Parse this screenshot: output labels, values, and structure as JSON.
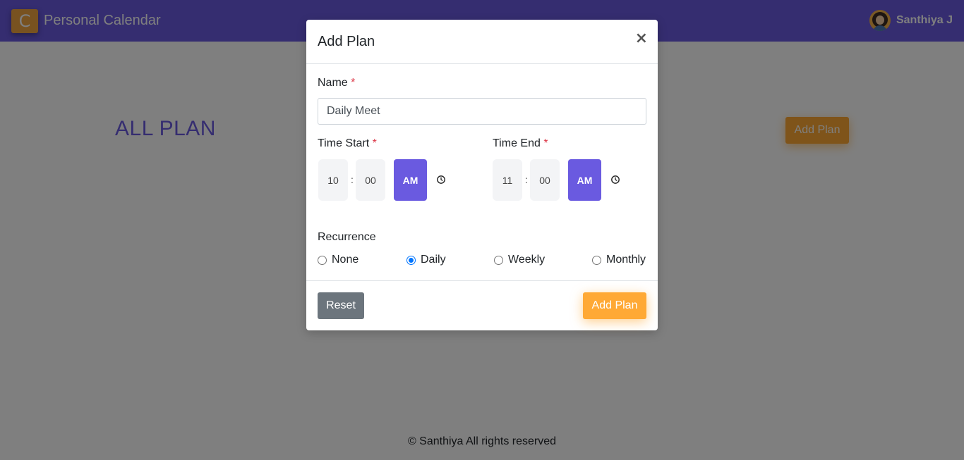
{
  "app": {
    "logo_letter": "C",
    "title": "Personal Calendar"
  },
  "user": {
    "name": "Santhiya J",
    "avatar_icon": "user-avatar"
  },
  "page": {
    "title": "ALL PLAN",
    "add_button": "Add Plan"
  },
  "footer": {
    "text": "© Santhiya All rights reserved"
  },
  "modal": {
    "title": "Add Plan",
    "close_label": "×",
    "name": {
      "label": "Name",
      "required": "*",
      "value": "Daily Meet"
    },
    "time_start": {
      "label": "Time Start",
      "required": "*",
      "hour": "10",
      "separator": ":",
      "minute": "00",
      "period": "AM"
    },
    "time_end": {
      "label": "Time End",
      "required": "*",
      "hour": "11",
      "separator": ":",
      "minute": "00",
      "period": "AM"
    },
    "recurrence": {
      "label": "Recurrence",
      "options": [
        "None",
        "Daily",
        "Weekly",
        "Monthly"
      ],
      "selected": "Daily"
    },
    "reset_label": "Reset",
    "submit_label": "Add Plan"
  },
  "colors": {
    "primary": "#6a5ae0",
    "accent": "#ffa935",
    "secondary": "#6c757d",
    "required": "#dc3545"
  }
}
